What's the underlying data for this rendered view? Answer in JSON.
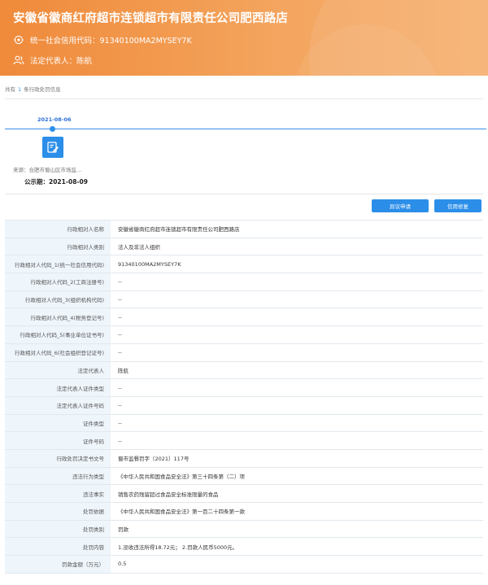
{
  "header": {
    "company_name": "安徽省徽商红府超市连锁超市有限责任公司肥西路店",
    "credit_code_line": "统一社会信用代码：91340100MA2MYSEY7K",
    "legal_rep_line": "法定代表人：陈航",
    "colors": {
      "gradient_start": "#ef8a3a",
      "gradient_end": "#f6b070"
    }
  },
  "summary": {
    "prefix": "共有",
    "count": "1",
    "suffix": "条行政处罚信息"
  },
  "timeline": {
    "date": "2021-08-06",
    "source": "来源：合肥市蜀山区市场监...",
    "publish_date": "公示期：2021-08-09",
    "icon": "edit-document-icon"
  },
  "actions": {
    "objection": "异议申请",
    "credit_repair": "信用修复"
  },
  "details": [
    {
      "label": "行政相对人名称",
      "value": "安徽省徽商红府超市连锁超市有限责任公司肥西路店"
    },
    {
      "label": "行政相对人类别",
      "value": "法人及非法人组织"
    },
    {
      "label": "行政相对人代码_1(统一社会信用代码)",
      "value": "91340100MA2MYSEY7K"
    },
    {
      "label": "行政相对人代码_2(工商注册号)",
      "value": "--"
    },
    {
      "label": "行政相对人代码_3(组织机构代码)",
      "value": "--"
    },
    {
      "label": "行政相对人代码_4(税务登记号)",
      "value": "--"
    },
    {
      "label": "行政相对人代码_5(事业单位证书号)",
      "value": "--"
    },
    {
      "label": "行政相对人代码_6(社会组织登记证号)",
      "value": "--"
    },
    {
      "label": "法定代表人",
      "value": "陈航"
    },
    {
      "label": "法定代表人证件类型",
      "value": "--"
    },
    {
      "label": "法定代表人证件号码",
      "value": "--"
    },
    {
      "label": "证件类型",
      "value": "--"
    },
    {
      "label": "证件号码",
      "value": "--"
    },
    {
      "label": "行政处罚决定书文号",
      "value": "蜀市监餐罚字〔2021〕117号"
    },
    {
      "label": "违法行为类型",
      "value": "《中华人民共和国食品安全法》第三十四条第（二）项"
    },
    {
      "label": "违法事实",
      "value": "销售农药残留超过食品安全标准限量的食品"
    },
    {
      "label": "处罚依据",
      "value": "《中华人民共和国食品安全法》第一百二十四条第一款"
    },
    {
      "label": "处罚类别",
      "value": "罚款"
    },
    {
      "label": "处罚内容",
      "value": "1.没收违法所得18.72元； 2.罚款人民币5000元。"
    },
    {
      "label": "罚款金额（万元）",
      "value": "0.5"
    }
  ]
}
